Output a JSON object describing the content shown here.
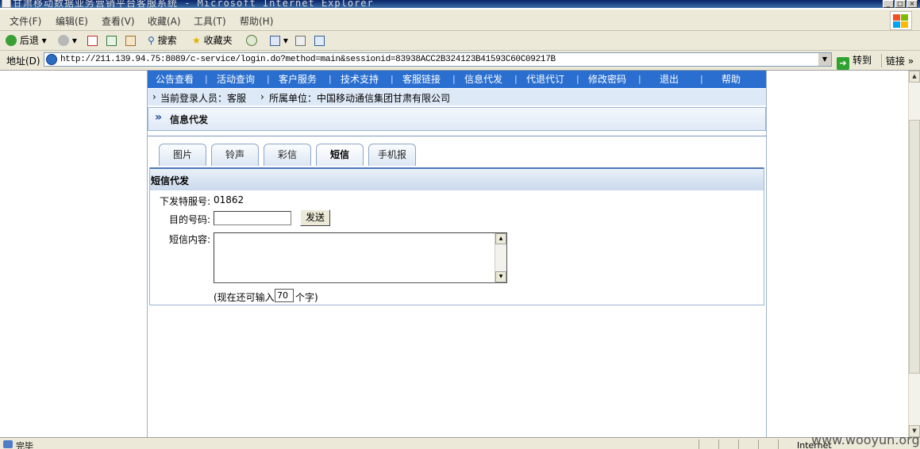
{
  "window": {
    "title": "甘肃移动数据业务营销平台客服系统 - Microsoft Internet Explorer"
  },
  "menu": [
    "文件(F)",
    "编辑(E)",
    "查看(V)",
    "收藏(A)",
    "工具(T)",
    "帮助(H)"
  ],
  "toolbar": {
    "back": "后退",
    "search": "搜索",
    "favorites": "收藏夹"
  },
  "address": {
    "label": "地址(D)",
    "url": "http://211.139.94.75:8089/c-service/login.do?method=main&sessionid=83938ACC2B324123B41593C60C09217B",
    "go": "转到",
    "links": "链接"
  },
  "nav": [
    "公告查看",
    "活动查询",
    "客户服务",
    "技术支持",
    "客服链接",
    "信息代发",
    "代退代订",
    "修改密码",
    "退出",
    "帮助"
  ],
  "user": {
    "login": "当前登录人员：客服",
    "unit": "所属单位：中国移动通信集团甘肃有限公司"
  },
  "section_title": "信息代发",
  "tabs": [
    {
      "label": "图片",
      "active": false
    },
    {
      "label": "铃声",
      "active": false
    },
    {
      "label": "彩信",
      "active": false
    },
    {
      "label": "短信",
      "active": true
    },
    {
      "label": "手机报",
      "active": false
    }
  ],
  "form": {
    "header": "短信代发",
    "service_label": "下发特服号:",
    "service_number": "01862",
    "dest_label": "目的号码:",
    "dest_value": "",
    "send": "发送",
    "content_label": "短信内容:",
    "content_value": "",
    "remain_prefix": "(现在还可输入",
    "remain_value": "70",
    "remain_suffix": "个字)"
  },
  "status": {
    "text": "完毕",
    "zone": "Internet"
  },
  "watermark": "www.wooyun.org"
}
